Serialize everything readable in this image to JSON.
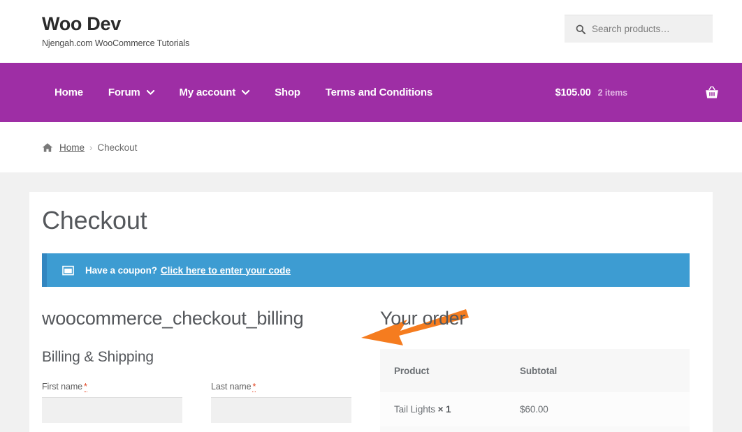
{
  "header": {
    "site_title": "Woo Dev",
    "tagline": "Njengah.com WooCommerce Tutorials",
    "search": {
      "placeholder": "Search products…",
      "value": "",
      "icon": "search-icon"
    }
  },
  "nav": {
    "background_color": "#9e2ea5",
    "items": [
      {
        "label": "Home",
        "has_dropdown": false
      },
      {
        "label": "Forum",
        "has_dropdown": true
      },
      {
        "label": "My account",
        "has_dropdown": true
      },
      {
        "label": "Shop",
        "has_dropdown": false
      },
      {
        "label": "Terms and Conditions",
        "has_dropdown": false
      }
    ],
    "cart": {
      "total": "$105.00",
      "count": "2 items",
      "icon": "shopping-basket-icon"
    }
  },
  "breadcrumb": {
    "home_icon": "home-icon",
    "home_label": "Home",
    "separator": "›",
    "current": "Checkout"
  },
  "page": {
    "title": "Checkout",
    "coupon": {
      "icon": "coupon-ticket-icon",
      "text": "Have a coupon?",
      "link_label": "Click here to enter your code",
      "background_color": "#3d9cd2",
      "border_color": "#3286c0"
    }
  },
  "billing": {
    "hook_name": "woocommerce_checkout_billing",
    "section_title": "Billing & Shipping",
    "fields": [
      {
        "label": "First name",
        "required_mark": "*",
        "value": "",
        "placeholder": ""
      },
      {
        "label": "Last name",
        "required_mark": "*",
        "value": "",
        "placeholder": ""
      }
    ]
  },
  "order": {
    "title": "Your order",
    "columns": [
      "Product",
      "Subtotal"
    ],
    "rows": [
      {
        "product": "Tail Lights",
        "qty": "× 1",
        "subtotal": "$60.00"
      }
    ]
  },
  "annotation": {
    "arrow_color": "#f57c1f",
    "points_at": "woocommerce_checkout_billing"
  }
}
